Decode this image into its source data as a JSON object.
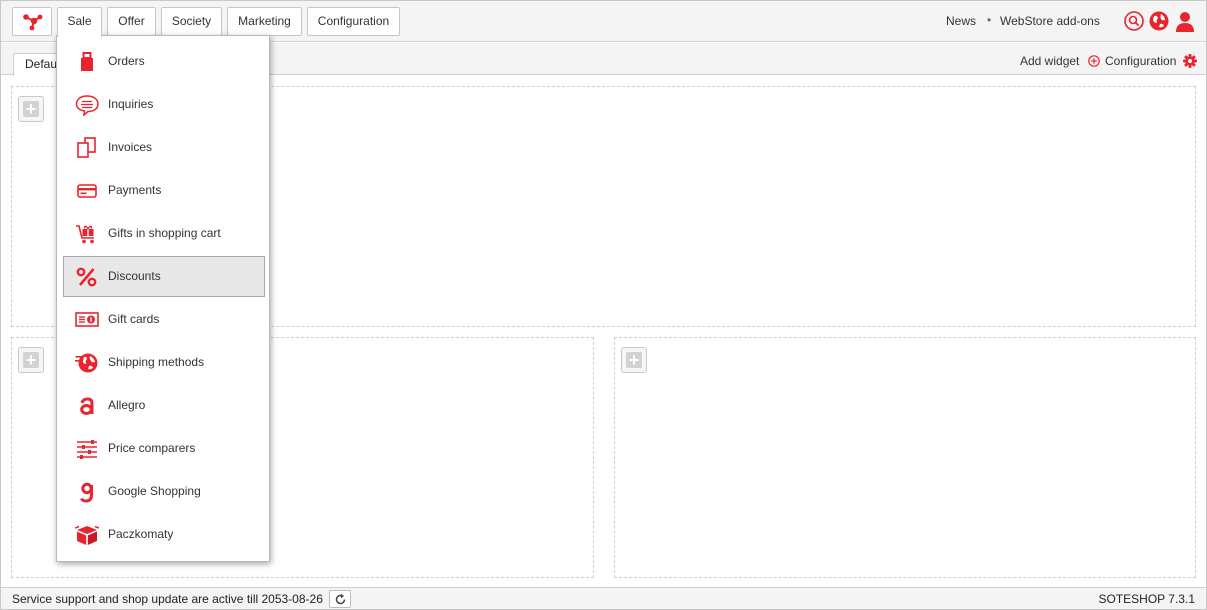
{
  "nav": {
    "items": [
      {
        "label": "Sale",
        "active": true
      },
      {
        "label": "Offer"
      },
      {
        "label": "Society"
      },
      {
        "label": "Marketing"
      },
      {
        "label": "Configuration"
      }
    ],
    "news": "News",
    "separator": "•",
    "addons": "WebStore add-ons",
    "icons": [
      "search-icon",
      "globe-icon",
      "user-icon"
    ]
  },
  "tabs": {
    "default_label": "Default"
  },
  "widgets": {
    "add_widget": "Add widget",
    "configuration": "Configuration"
  },
  "menu": {
    "items": [
      {
        "label": "Orders",
        "icon": "bag-icon"
      },
      {
        "label": "Inquiries",
        "icon": "speech-bubble-icon"
      },
      {
        "label": "Invoices",
        "icon": "documents-icon"
      },
      {
        "label": "Payments",
        "icon": "credit-card-icon"
      },
      {
        "label": "Gifts in shopping cart",
        "icon": "gift-cart-icon"
      },
      {
        "label": "Discounts",
        "icon": "percent-icon",
        "highlighted": true
      },
      {
        "label": "Gift cards",
        "icon": "gift-card-icon"
      },
      {
        "label": "Shipping methods",
        "icon": "shipping-globe-icon"
      },
      {
        "label": "Allegro",
        "icon": "allegro-icon"
      },
      {
        "label": "Price comparers",
        "icon": "sliders-icon"
      },
      {
        "label": "Google Shopping",
        "icon": "google-g-icon"
      },
      {
        "label": "Paczkomaty",
        "icon": "parcel-box-icon"
      }
    ]
  },
  "status": {
    "text": "Service support and shop update are active till 2053-08-26",
    "version": "SOTESHOP 7.3.1"
  },
  "colors": {
    "accent": "#e8242f",
    "highlight_bg": "#e8e8e8"
  }
}
